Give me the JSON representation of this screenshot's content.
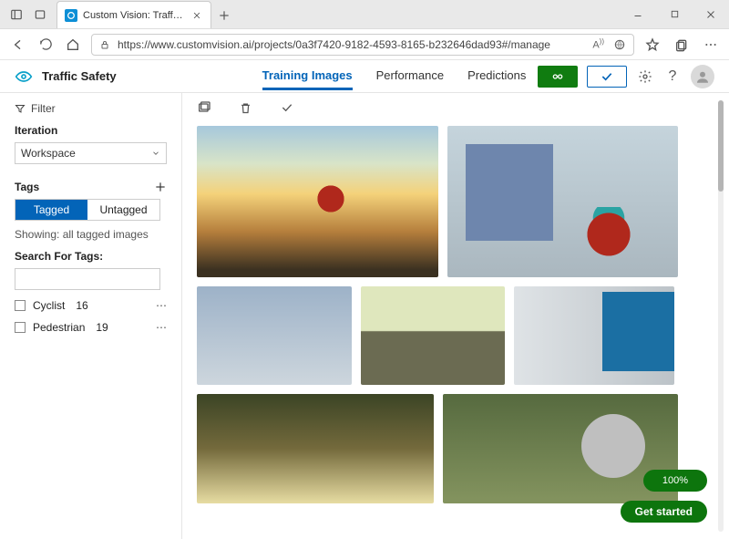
{
  "browser": {
    "tab_title": "Custom Vision: Traffic Safety - Tr",
    "url": "https://www.customvision.ai/projects/0a3f7420-9182-4593-8165-b232646dad93#/manage"
  },
  "header": {
    "project_name": "Traffic Safety",
    "tabs": {
      "training": "Training Images",
      "performance": "Performance",
      "predictions": "Predictions"
    }
  },
  "sidebar": {
    "filter_label": "Filter",
    "iteration_label": "Iteration",
    "iteration_value": "Workspace",
    "tags_label": "Tags",
    "seg_tagged": "Tagged",
    "seg_untagged": "Untagged",
    "showing_text": "Showing: all tagged images",
    "search_label": "Search For Tags:",
    "tags": [
      {
        "name": "Cyclist",
        "count": "16"
      },
      {
        "name": "Pedestrian",
        "count": "19"
      }
    ]
  },
  "footer": {
    "progress": "100%",
    "get_started": "Get started"
  }
}
